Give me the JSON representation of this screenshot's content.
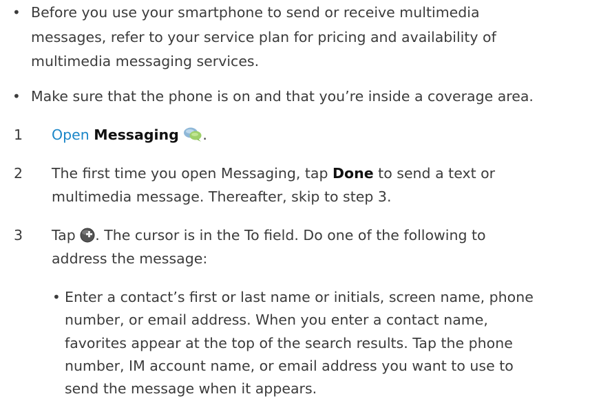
{
  "bullets": [
    {
      "lines": [
        "Before you use your smartphone to send or receive multimedia",
        "messages, refer to your service plan for pricing and availability of",
        "multimedia messaging services."
      ]
    },
    {
      "lines": [
        "Make sure that the phone is on and that you’re inside a coverage area."
      ]
    }
  ],
  "steps": [
    {
      "number": "1",
      "link_text": "Open",
      "bold_text": "Messaging",
      "after_icon": ".",
      "icon": "messaging-bubble-icon"
    },
    {
      "number": "2",
      "line1_before": "The first time you open Messaging, tap",
      "line1_bold": "Done",
      "line1_after": "to send a text or",
      "line2": "multimedia message. Thereafter, skip to step 3."
    },
    {
      "number": "3",
      "before_icon": "Tap",
      "icon": "new-message-plus-icon",
      "line1_after": ". The cursor is in the To field. Do one of the following to",
      "line2": "address the message:"
    }
  ],
  "sub_bullet": {
    "lines": [
      "Enter a contact’s first or last name or initials, screen name, phone",
      "number, or email address. When you enter a contact name,",
      "favorites appear at the top of the search results. Tap the phone",
      "number, IM account name, or email address you want to use to",
      "send the message when it appears."
    ]
  }
}
